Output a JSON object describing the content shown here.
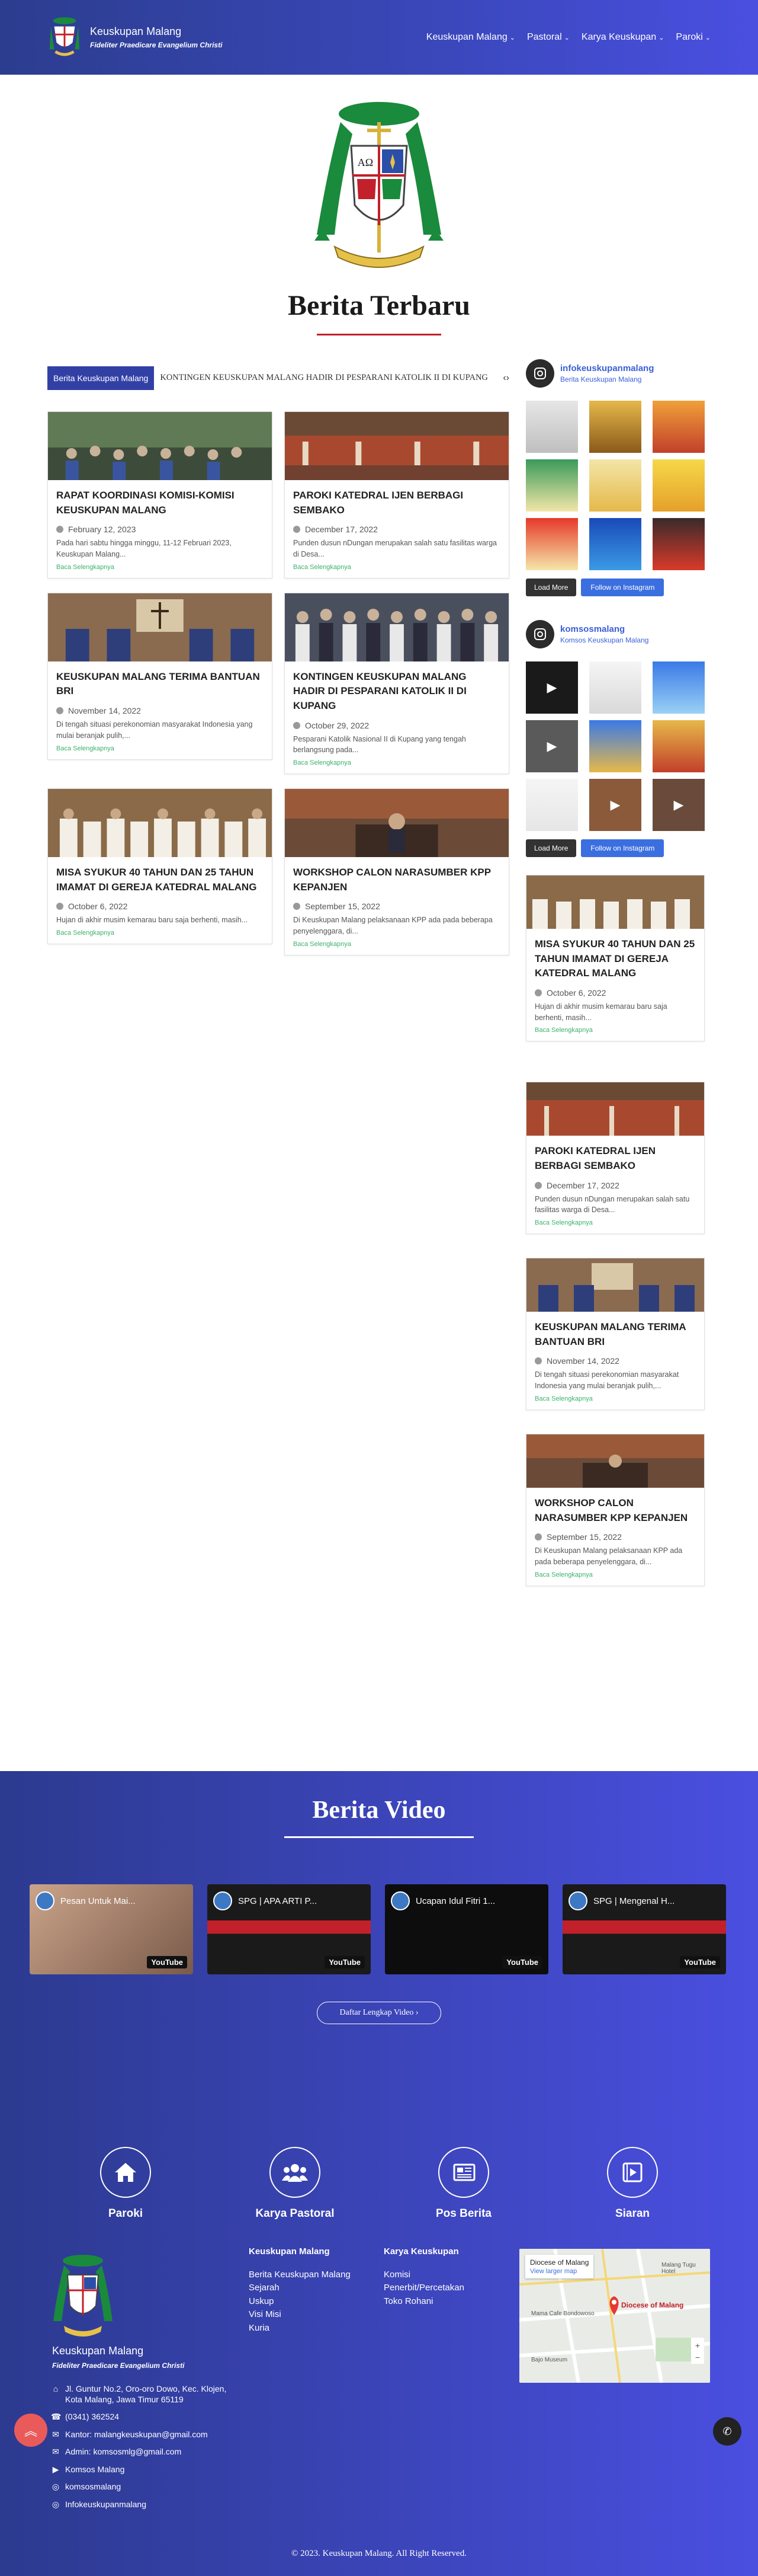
{
  "header": {
    "title": "Keuskupan Malang",
    "tagline": "Fideliter Praedicare Evangelium Christi",
    "nav": [
      {
        "label": "Keuskupan Malang"
      },
      {
        "label": "Pastoral"
      },
      {
        "label": "Karya Keuskupan"
      },
      {
        "label": "Paroki"
      }
    ]
  },
  "hero": {
    "title": "Berita Terbaru"
  },
  "ticker": {
    "badge": "Berita Keuskupan Malang",
    "headline": "KONTINGEN KEUSKUPAN MALANG HADIR DI PESPARANI KATOLIK II DI KUPANG",
    "controls": "‹›"
  },
  "posts": [
    {
      "title": "RAPAT KOORDINASI KOMISI-KOMISI KEUSKUPAN MALANG",
      "date": "February 12, 2023",
      "excerpt": "Pada hari sabtu hingga minggu, 11-12 Februari 2023, Keuskupan Malang...",
      "more": "Baca Selengkapnya"
    },
    {
      "title": "PAROKI KATEDRAL IJEN BERBAGI SEMBAKO",
      "date": "December 17, 2022",
      "excerpt": "Punden dusun nDungan merupakan salah satu fasilitas warga di Desa...",
      "more": "Baca Selengkapnya"
    },
    {
      "title": "KEUSKUPAN MALANG TERIMA BANTUAN BRI",
      "date": "November 14, 2022",
      "excerpt": "Di tengah situasi perekonomian masyarakat Indonesia yang mulai beranjak pulih,...",
      "more": "Baca Selengkapnya"
    },
    {
      "title": "KONTINGEN KEUSKUPAN MALANG HADIR DI PESPARANI KATOLIK II DI KUPANG",
      "date": "October 29, 2022",
      "excerpt": "Pesparani Katolik Nasional II di Kupang yang tengah berlangsung pada...",
      "more": "Baca Selengkapnya"
    },
    {
      "title": "MISA SYUKUR 40 TAHUN dan 25 TAHUN IMAMAT DI GEREJA KATEDRAL MALANG",
      "date": "October 6, 2022",
      "excerpt": " Hujan di akhir musim kemarau  baru saja berhenti, masih...",
      "more": "Baca Selengkapnya"
    },
    {
      "title": "WORKSHOP CALON NARASUMBER KPP KEPANJEN",
      "date": "September 15, 2022",
      "excerpt": "Di Keuskupan Malang pelaksanaan KPP ada pada beberapa penyelenggara, di...",
      "more": "Baca Selengkapnya"
    }
  ],
  "instagram": [
    {
      "handle": "infokeuskupanmalang",
      "name": "Berita Keuskupan Malang",
      "load": "Load More",
      "follow": "Follow on Instagram"
    },
    {
      "handle": "komsosmalang",
      "name": "Komsos Keuskupan Malang",
      "load": "Load More",
      "follow": "Follow on Instagram"
    }
  ],
  "sidebar_posts": [
    {
      "title": "MISA SYUKUR 40 TAHUN dan 25 TAHUN IMAMAT DI GEREJA KATEDRAL MALANG",
      "date": "October 6, 2022",
      "excerpt": " Hujan di akhir musim kemarau  baru saja berhenti, masih...",
      "more": "Baca Selengkapnya"
    },
    {
      "title": "PAROKI KATEDRAL IJEN BERBAGI SEMBAKO",
      "date": "December 17, 2022",
      "excerpt": "Punden dusun nDungan merupakan salah satu fasilitas warga di Desa...",
      "more": "Baca Selengkapnya"
    },
    {
      "title": "KEUSKUPAN MALANG TERIMA BANTUAN BRI",
      "date": "November 14, 2022",
      "excerpt": "Di tengah situasi perekonomian masyarakat Indonesia yang mulai beranjak pulih,...",
      "more": "Baca Selengkapnya"
    },
    {
      "title": "WORKSHOP CALON NARASUMBER KPP KEPANJEN",
      "date": "September 15, 2022",
      "excerpt": "Di Keuskupan Malang pelaksanaan KPP ada pada beberapa penyelenggara, di...",
      "more": "Baca Selengkapnya"
    }
  ],
  "video": {
    "title": "Berita Video",
    "items": [
      {
        "title": "Pesan Untuk Mai...",
        "badge": "YouTube"
      },
      {
        "title": "SPG | APA ARTI P...",
        "badge": "YouTube"
      },
      {
        "title": "Ucapan Idul Fitri 1...",
        "badge": "YouTube"
      },
      {
        "title": "SPG | Mengenal H...",
        "badge": "YouTube"
      }
    ],
    "button": "Daftar Lengkap Video  ›"
  },
  "footer": {
    "services": [
      {
        "label": "Paroki",
        "icon": "home-icon"
      },
      {
        "label": "Karya Pastoral",
        "icon": "users-icon"
      },
      {
        "label": "Pos Berita",
        "icon": "newspaper-icon"
      },
      {
        "label": "Siaran",
        "icon": "video-icon"
      }
    ],
    "name": "Keuskupan Malang",
    "tagline": "Fideliter Praedicare Evangelium Christi",
    "contacts": {
      "address": "Jl. Guntur No.2, Oro-oro Dowo, Kec. Klojen, Kota Malang, Jawa Timur 65119",
      "phone": "(0341) 362524",
      "office": "Kantor: malangkeuskupan@gmail.com",
      "admin": "Admin: komsosmlg@gmail.com",
      "youtube": "Komsos Malang",
      "instagram1": "komsosmalang",
      "instagram2": "Infokeuskupanmalang"
    },
    "col1": {
      "heading": "Keuskupan Malang",
      "links": [
        "Berita Keuskupan Malang",
        "Sejarah",
        "Uskup",
        "Visi Misi",
        "Kuria"
      ]
    },
    "col2": {
      "heading": "Karya Keuskupan",
      "links": [
        "Komisi",
        "Penerbit/Percetakan",
        "Toko Rohani"
      ]
    },
    "map": {
      "place": "Diocese of Malang",
      "link": "View larger map",
      "pin": "Diocese of Malang",
      "poi1": "Malang Tugu Hotel",
      "poi2": "Mama Cafe Bondowoso",
      "poi3": "Bajo Museum"
    },
    "copyright": "© 2023. Keuskupan Malang. All Right Reserved."
  }
}
